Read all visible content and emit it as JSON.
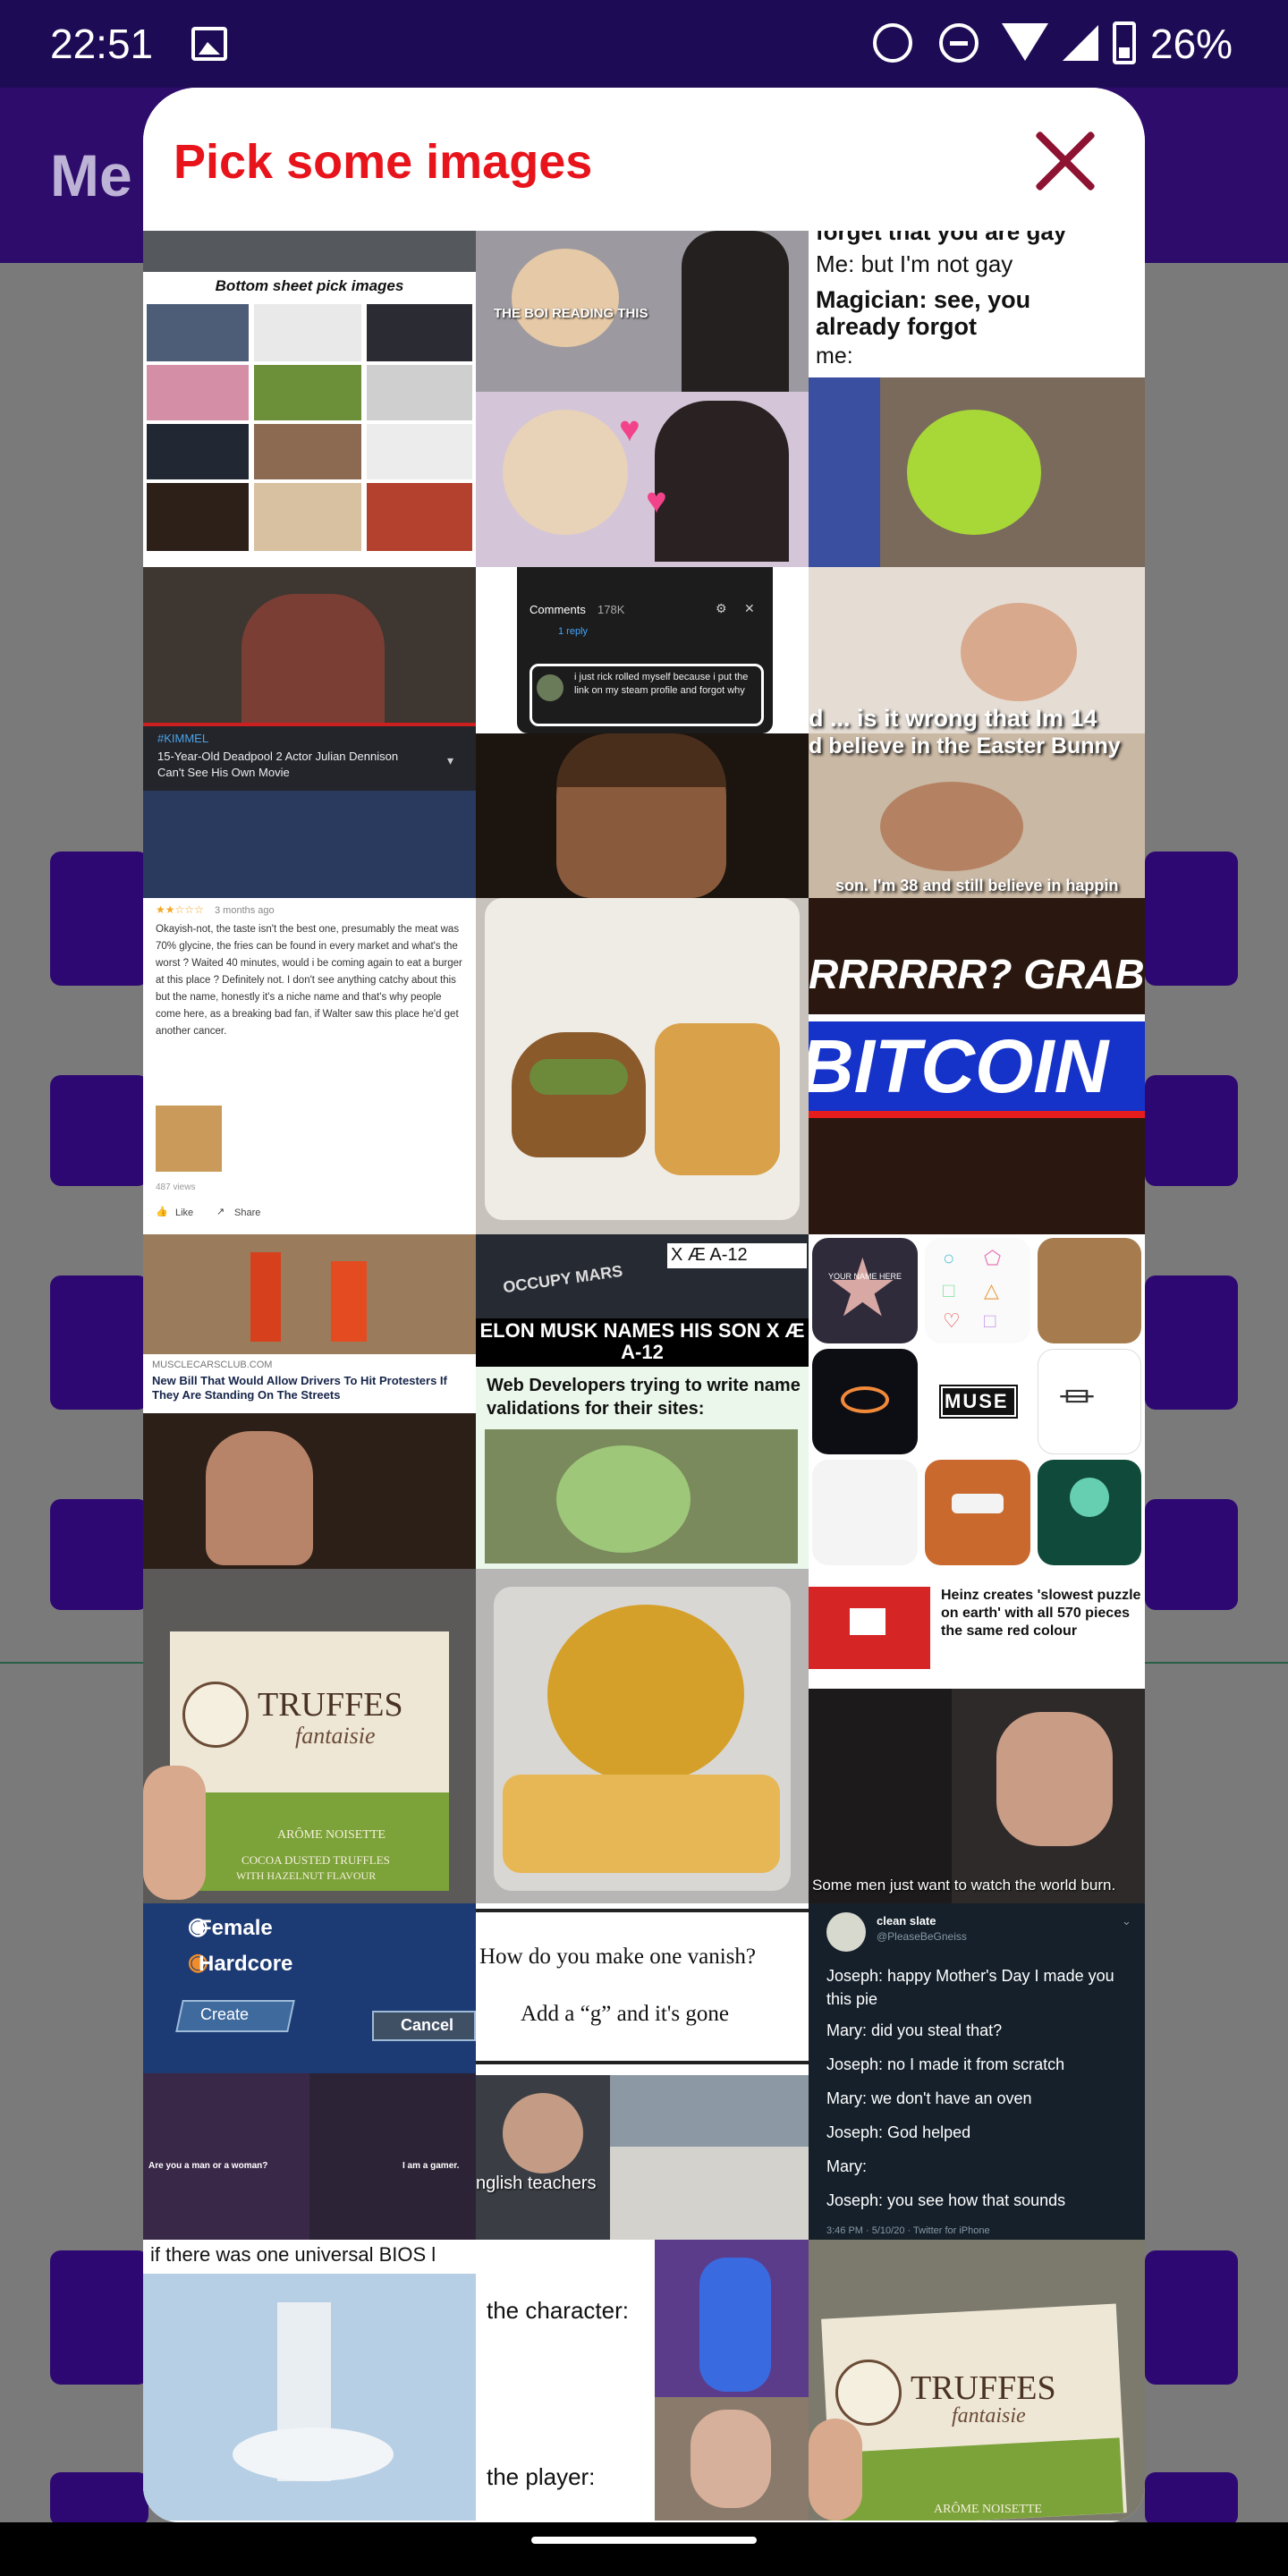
{
  "status_bar": {
    "time": "22:51",
    "battery": "26%",
    "icons": [
      "gallery-icon",
      "alarm-icon",
      "do-not-disturb-icon",
      "wifi-icon",
      "signal-icon",
      "battery-icon"
    ]
  },
  "background_app": {
    "title": "Me"
  },
  "sheet": {
    "title": "Pick some images",
    "close_icon": "close-icon",
    "accent": "#e8141c"
  },
  "images": {
    "c1": {
      "t1": {
        "caption": "Bottom sheet pick images"
      },
      "t2": {
        "caption": "#KIMMEL",
        "line1": "15-Year-Old Deadpool 2 Actor Julian Dennison",
        "line2": "Can't See His Own Movie"
      },
      "t3": {
        "meta": "3 months ago",
        "review": "Okayish-not, the taste isn't the best one, presumably the meat was 70% glycine, the fries can be found in every market and what's the worst ? Waited 40 minutes, would i be coming again to eat a burger at this place ? Definitely not. I don't see anything catchy about this but the name, honestly it's a niche name and that's why people come here, as a breaking bad fan, if Walter saw this place he'd get another cancer.",
        "views": "487 views",
        "like": "Like",
        "share": "Share"
      },
      "t4": {
        "source": "MUSCLECARSCLUB.COM",
        "headline": "New Bill That Would Allow Drivers To Hit Protesters If They Are Standing On The Streets"
      },
      "t5": {
        "brand": "TRUFFES",
        "sub": "fantaisie",
        "line1": "ARÔME NOISETTE",
        "line2": "COCOA DUSTED TRUFFLES",
        "line3": "WITH HAZELNUT FLAVOUR"
      },
      "t6": {
        "opt1": "Female",
        "opt2": "Hardcore",
        "btn1": "Create",
        "btn2": "Cancel",
        "q": "Are you a man or a woman?",
        "a": "I am a gamer."
      },
      "t7": {
        "caption": "if there was one universal BIOS l"
      }
    },
    "c2": {
      "t1": {
        "caption": "THE BOI READING THIS"
      },
      "t2": {
        "title": "Comments",
        "count": "178K",
        "reply": "1 reply",
        "comment": "i just rick rolled myself because i put the link on my steam profile and forgot why"
      },
      "t4": {
        "tag": "X Æ A-12",
        "shirt": "OCCUPY MARS",
        "headline": "ELON MUSK NAMES HIS SON X Æ A-12",
        "caption": "Web Developers trying to write name validations for their sites:"
      },
      "t6": {
        "line1": "How do you make one vanish?",
        "line2": "Add a “g” and it's gone",
        "caption": "nglish teachers"
      },
      "t7": {
        "line1": "the character:",
        "line2": "the player:"
      }
    },
    "c3": {
      "t1": {
        "line0": "forget that you are gay",
        "line1": "Me: but I'm not gay",
        "line2": "Magician: see, you already forgot",
        "line3": "me:"
      },
      "t2": {
        "line1": "d ... is it wrong that Im 14",
        "line2": "d believe in the Easter Bunny",
        "line3": "son. I'm 38 and still believe in happin"
      },
      "t3": {
        "line1": "RRRRRR? GRAB",
        "line2": "BITCOIN"
      },
      "t4": {
        "star": "YOUR NAME HERE",
        "band": "MUSE"
      },
      "t5": {
        "caption": "Heinz creates 'slowest puzzle on earth' with all 570 pieces the same red colour",
        "movie": "Some men just want to watch the world burn."
      },
      "t6": {
        "name": "clean slate",
        "handle": "@PleaseBeGneiss",
        "lines": [
          "Joseph: happy Mother's Day I made you this pie",
          "Mary: did you steal that?",
          "Joseph: no I made it from scratch",
          "Mary: we don't have an oven",
          "Joseph: God helped",
          "Mary:",
          "Joseph: you see how that sounds"
        ],
        "footer": "3:46 PM · 5/10/20 · Twitter for iPhone"
      },
      "t7": {
        "brand": "TRUFFES",
        "sub": "fantaisie",
        "line1": "ARÔME NOISETTE"
      }
    }
  }
}
